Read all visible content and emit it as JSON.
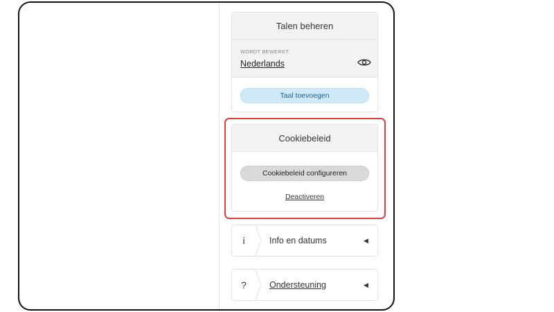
{
  "languages": {
    "title": "Talen beheren",
    "editing_label": "WORDT BEWERKT:",
    "editing_language": "Nederlands",
    "preview_icon": "eye-icon",
    "add_language_button": "Taal toevoegen"
  },
  "cookie_policy": {
    "title": "Cookiebeleid",
    "configure_button": "Cookiebeleid configureren",
    "deactivate_link": "Deactiveren"
  },
  "accordions": [
    {
      "icon": "i",
      "icon_name": "info-icon",
      "label": "Info en datums"
    },
    {
      "icon": "?",
      "icon_name": "help-icon",
      "label": "Ondersteuning"
    }
  ],
  "colors": {
    "highlight": "#e23b3b",
    "annotation_arrow": "#e23b3b",
    "primary_pill": "#cfe9fb"
  }
}
